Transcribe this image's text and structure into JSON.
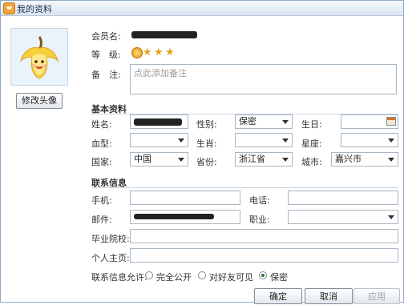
{
  "window": {
    "title": "我的资料"
  },
  "sidebar": {
    "edit_avatar_label": "修改头像"
  },
  "basic": {
    "member_name_label": "会员名:",
    "level_label": "等　级:",
    "note_label": "备　注:",
    "note_placeholder": "点此添加备注"
  },
  "section_basic": {
    "title": "基本资料"
  },
  "profile": {
    "name_label": "姓名:",
    "gender_label": "性别:",
    "gender_value": "保密",
    "birthday_label": "生日:",
    "blood_label": "血型:",
    "zodiac_label": "生肖:",
    "constellation_label": "星座:",
    "country_label": "国家:",
    "country_value": "中国",
    "province_label": "省份:",
    "province_value": "浙江省",
    "city_label": "城市:",
    "city_value": "嘉兴市"
  },
  "section_contact": {
    "title": "联系信息"
  },
  "contact": {
    "mobile_label": "手机:",
    "phone_label": "电话:",
    "email_label": "邮件:",
    "job_label": "职业:",
    "school_label": "毕业院校:",
    "homepage_label": "个人主页:"
  },
  "privacy": {
    "label": "联系信息允许:",
    "options": [
      "完全公开",
      "对好友可见",
      "保密"
    ],
    "selected_index": 2
  },
  "footer": {
    "ok_label": "确定",
    "cancel_label": "取消",
    "apply_label": "应用"
  },
  "icons": {
    "title_icon": "app-icon",
    "avatar": "banana-avatar",
    "level": [
      "sun-icon",
      "star-icon",
      "star-icon",
      "star-icon"
    ]
  }
}
